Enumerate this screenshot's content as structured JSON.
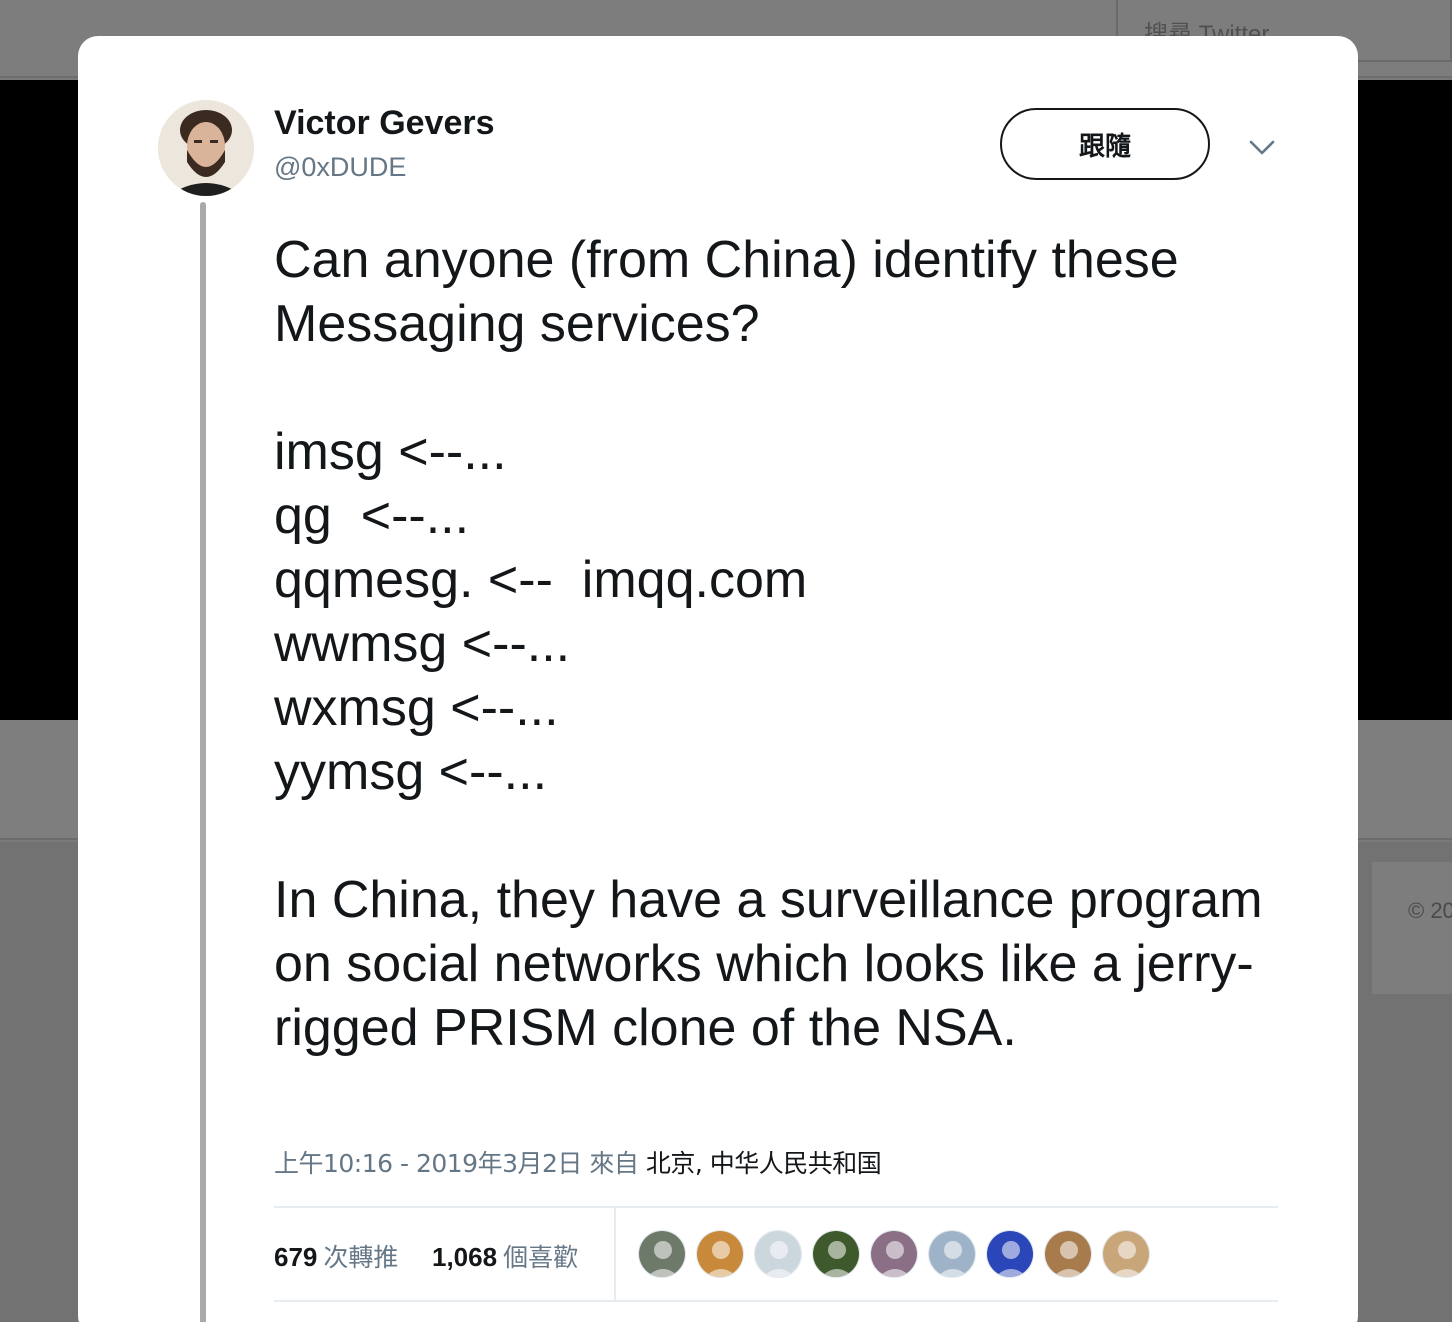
{
  "background": {
    "search_placeholder": "搜尋 Twitter",
    "copyright": "© 20"
  },
  "tweet": {
    "author": {
      "name": "Victor Gevers",
      "handle": "@0xDUDE"
    },
    "follow_label": "跟隨",
    "text": "Can anyone (from China) identify these Messaging services?\n\nimsg <--...\nqg  <--...\nqqmesg. <--  imqq.com\nwwmsg <--...\nwxmsg <--...\nyymsg <--...\n\nIn China, they have a surveillance program on social networks which looks like a jerry-rigged PRISM clone of the NSA.",
    "time": "上午10:16 - 2019年3月2日",
    "from_label": "來自",
    "location": "北京, 中华人民共和国",
    "retweets": {
      "count": "679",
      "label": "次轉推"
    },
    "likes": {
      "count": "1,068",
      "label": "個喜歡"
    },
    "likers": [
      {
        "icon": "liker-avatar-tower",
        "color": "#6d7a6a"
      },
      {
        "icon": "liker-avatar-lion",
        "color": "#c9893a"
      },
      {
        "icon": "liker-avatar-default",
        "color": "#ccd6dd"
      },
      {
        "icon": "liker-avatar-person-green",
        "color": "#3e5a2c"
      },
      {
        "icon": "liker-avatar-person-purple",
        "color": "#8a6f86"
      },
      {
        "icon": "liker-avatar-person-suit",
        "color": "#9fb3c8"
      },
      {
        "icon": "liker-avatar-brain-blue",
        "color": "#2a46b8"
      },
      {
        "icon": "liker-avatar-cat",
        "color": "#a87b4d"
      },
      {
        "icon": "liker-avatar-tools",
        "color": "#c9a57a"
      }
    ]
  }
}
